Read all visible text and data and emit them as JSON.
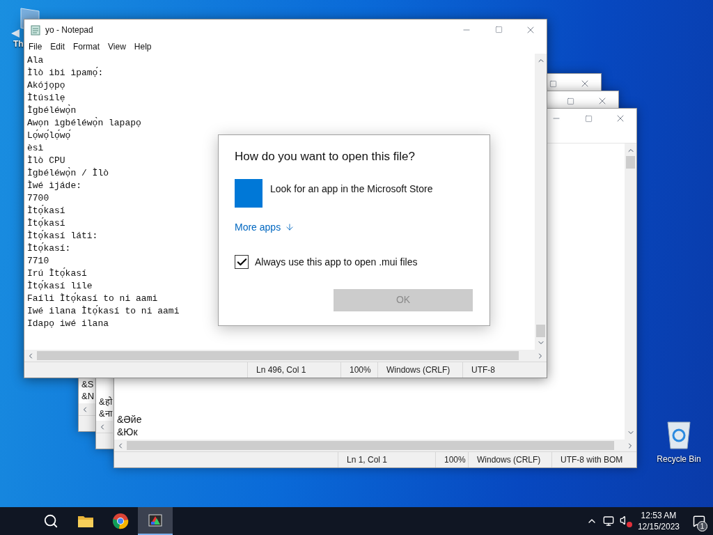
{
  "desktop_icons": [
    {
      "kind": "shortcut",
      "label": "Th"
    },
    {
      "kind": "recycle",
      "label": "Recycle Bin"
    }
  ],
  "background_windows": [
    {
      "lines": [
        "&S",
        "&N"
      ],
      "controls": [
        {
          "kind": "maximize"
        },
        {
          "kind": "close"
        }
      ]
    },
    {
      "lines": [
        "&हो",
        "&ना"
      ],
      "controls": [
        {
          "kind": "maximize"
        },
        {
          "kind": "close"
        }
      ]
    },
    {
      "lines": [
        "&Әйе",
        "&Юк"
      ],
      "controls": [
        {
          "kind": "minimize"
        },
        {
          "kind": "maximize"
        },
        {
          "kind": "close"
        }
      ],
      "status": [
        "Ln 1, Col 1",
        "100%",
        "Windows (CRLF)",
        "UTF-8 with BOM"
      ]
    }
  ],
  "notepad": {
    "title": "yo - Notepad",
    "menu": [
      "File",
      "Edit",
      "Format",
      "View",
      "Help"
    ],
    "lines": [
      "Ala",
      "Ìlò ibi ìpamọ́:",
      "Akójọpọ",
      "Ìtúsilẹ",
      "Ìgbéléwọ̀n",
      "Awọn ìgbéléwọ̀n lapapọ",
      "Lọ́wọ́lọ́wọ́",
      "èsì",
      "Ìlò CPU",
      "Ìgbéléwọ̀n / Ìlò",
      "Ìwé ìjáde:",
      "7700",
      "Ìtọ́kasí",
      "Ìtọ́kasí",
      "Ìtọ́kasí láti:",
      "Ìtọ́kasí:",
      "7710",
      "Irú Ìtọ́kasí",
      "Ìtọ́kasí lile",
      "Faíli Ìtọ́kasí to ni aami",
      "Iwé ilana Ìtọ́kasí to ni aami",
      "Idapọ iwé ilana"
    ],
    "status": [
      "Ln 496, Col 1",
      "100%",
      "Windows (CRLF)",
      "UTF-8"
    ]
  },
  "dialog": {
    "title": "How do you want to open this file?",
    "store_option": "Look for an app in the Microsoft Store",
    "more_apps": "More apps",
    "checkbox": {
      "label": "Always use this app to open .mui files",
      "checked": true
    },
    "ok_button": {
      "label": "OK",
      "disabled": true
    }
  },
  "taskbar": {
    "apps": [
      {
        "kind": "search",
        "active": false
      },
      {
        "kind": "folder",
        "active": false
      },
      {
        "kind": "browser",
        "active": false
      },
      {
        "kind": "app",
        "active": true
      }
    ],
    "time": "12:53 AM",
    "date": "12/15/2023",
    "notification_count": "1"
  }
}
